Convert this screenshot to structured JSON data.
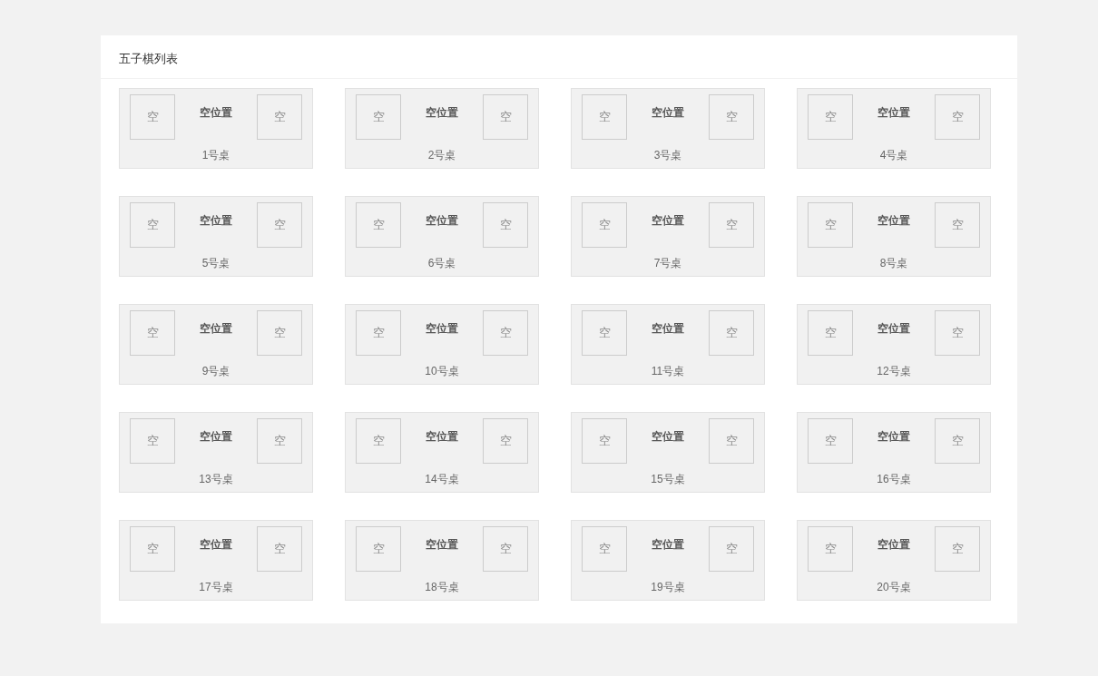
{
  "panel": {
    "title": "五子棋列表"
  },
  "tables": [
    {
      "label": "1号桌",
      "status": "空位置",
      "seats": [
        "空",
        "空"
      ]
    },
    {
      "label": "2号桌",
      "status": "空位置",
      "seats": [
        "空",
        "空"
      ]
    },
    {
      "label": "3号桌",
      "status": "空位置",
      "seats": [
        "空",
        "空"
      ]
    },
    {
      "label": "4号桌",
      "status": "空位置",
      "seats": [
        "空",
        "空"
      ]
    },
    {
      "label": "5号桌",
      "status": "空位置",
      "seats": [
        "空",
        "空"
      ]
    },
    {
      "label": "6号桌",
      "status": "空位置",
      "seats": [
        "空",
        "空"
      ]
    },
    {
      "label": "7号桌",
      "status": "空位置",
      "seats": [
        "空",
        "空"
      ]
    },
    {
      "label": "8号桌",
      "status": "空位置",
      "seats": [
        "空",
        "空"
      ]
    },
    {
      "label": "9号桌",
      "status": "空位置",
      "seats": [
        "空",
        "空"
      ]
    },
    {
      "label": "10号桌",
      "status": "空位置",
      "seats": [
        "空",
        "空"
      ]
    },
    {
      "label": "11号桌",
      "status": "空位置",
      "seats": [
        "空",
        "空"
      ]
    },
    {
      "label": "12号桌",
      "status": "空位置",
      "seats": [
        "空",
        "空"
      ]
    },
    {
      "label": "13号桌",
      "status": "空位置",
      "seats": [
        "空",
        "空"
      ]
    },
    {
      "label": "14号桌",
      "status": "空位置",
      "seats": [
        "空",
        "空"
      ]
    },
    {
      "label": "15号桌",
      "status": "空位置",
      "seats": [
        "空",
        "空"
      ]
    },
    {
      "label": "16号桌",
      "status": "空位置",
      "seats": [
        "空",
        "空"
      ]
    },
    {
      "label": "17号桌",
      "status": "空位置",
      "seats": [
        "空",
        "空"
      ]
    },
    {
      "label": "18号桌",
      "status": "空位置",
      "seats": [
        "空",
        "空"
      ]
    },
    {
      "label": "19号桌",
      "status": "空位置",
      "seats": [
        "空",
        "空"
      ]
    },
    {
      "label": "20号桌",
      "status": "空位置",
      "seats": [
        "空",
        "空"
      ]
    }
  ]
}
